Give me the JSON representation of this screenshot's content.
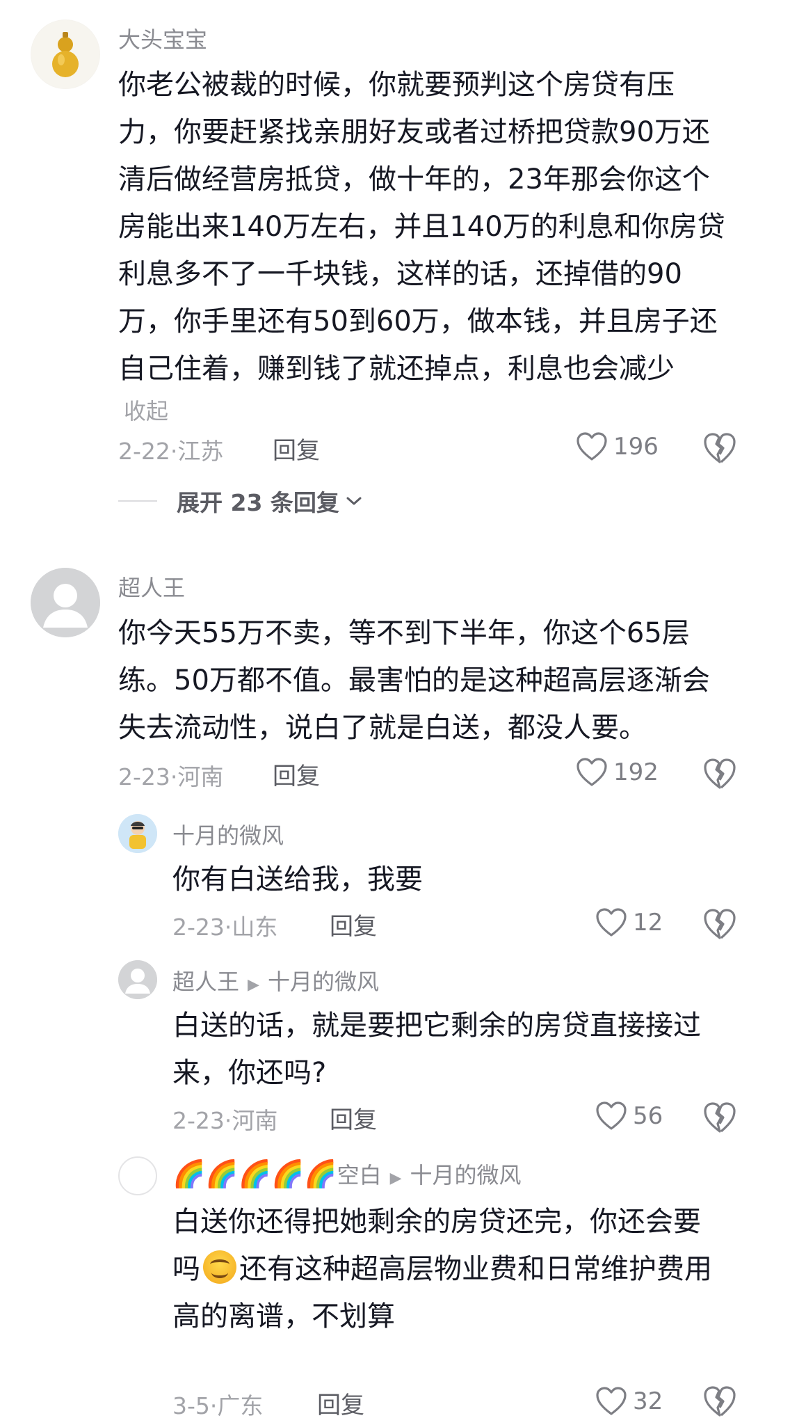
{
  "comments": [
    {
      "user": "大头宝宝",
      "text": "你老公被裁的时候，你就要预判这个房贷有压\n力，你要赶紧找亲朋好友或者过桥把贷款90万还\n清后做经营房抵贷，做十年的，23年那会你这个\n房能出来140万左右，并且140万的利息和你房贷\n利息多不了一千块钱，这样的话，还掉借的90\n万，你手里还有50到60万，做本钱，并且房子还\n自己住着，赚到钱了就还掉点，利息也会减少",
      "collapse": "收起",
      "meta": "2-22·江苏",
      "reply": "回复",
      "likes": "196",
      "expand": "展开 23 条回复"
    },
    {
      "user": "超人王",
      "text": "你今天55万不卖，等不到下半年，你这个65层\n练。50万都不值。最害怕的是这种超高层逐渐会\n失去流动性，说白了就是白送，都没人要。",
      "meta": "2-23·河南",
      "reply": "回复",
      "likes": "192"
    }
  ],
  "replies": [
    {
      "user": "十月的微风",
      "text": "你有白送给我，我要",
      "meta": "2-23·山东",
      "reply": "回复",
      "likes": "12"
    },
    {
      "user": "超人王",
      "target": "十月的微风",
      "text": "白送的话，就是要把它剩余的房贷直接接过\n来，你还吗?",
      "meta": "2-23·河南",
      "reply": "回复",
      "likes": "56"
    },
    {
      "user_emoji": "🌈🌈🌈🌈🌈",
      "user": "空白",
      "target": "十月的微风",
      "text_line1": "白送你还得把她剩余的房贷还完，你还会要",
      "text_line2_a": "吗",
      "text_line2_b": "还有这种超高层物业费和日常维护费用",
      "text_line3": "高的离谱，不划算",
      "meta": "3-5·广东",
      "reply": "回复",
      "likes": "32"
    }
  ],
  "colors": {
    "text": "#161823",
    "secondary": "#8a8b91",
    "meta": "#a2a3a8"
  }
}
